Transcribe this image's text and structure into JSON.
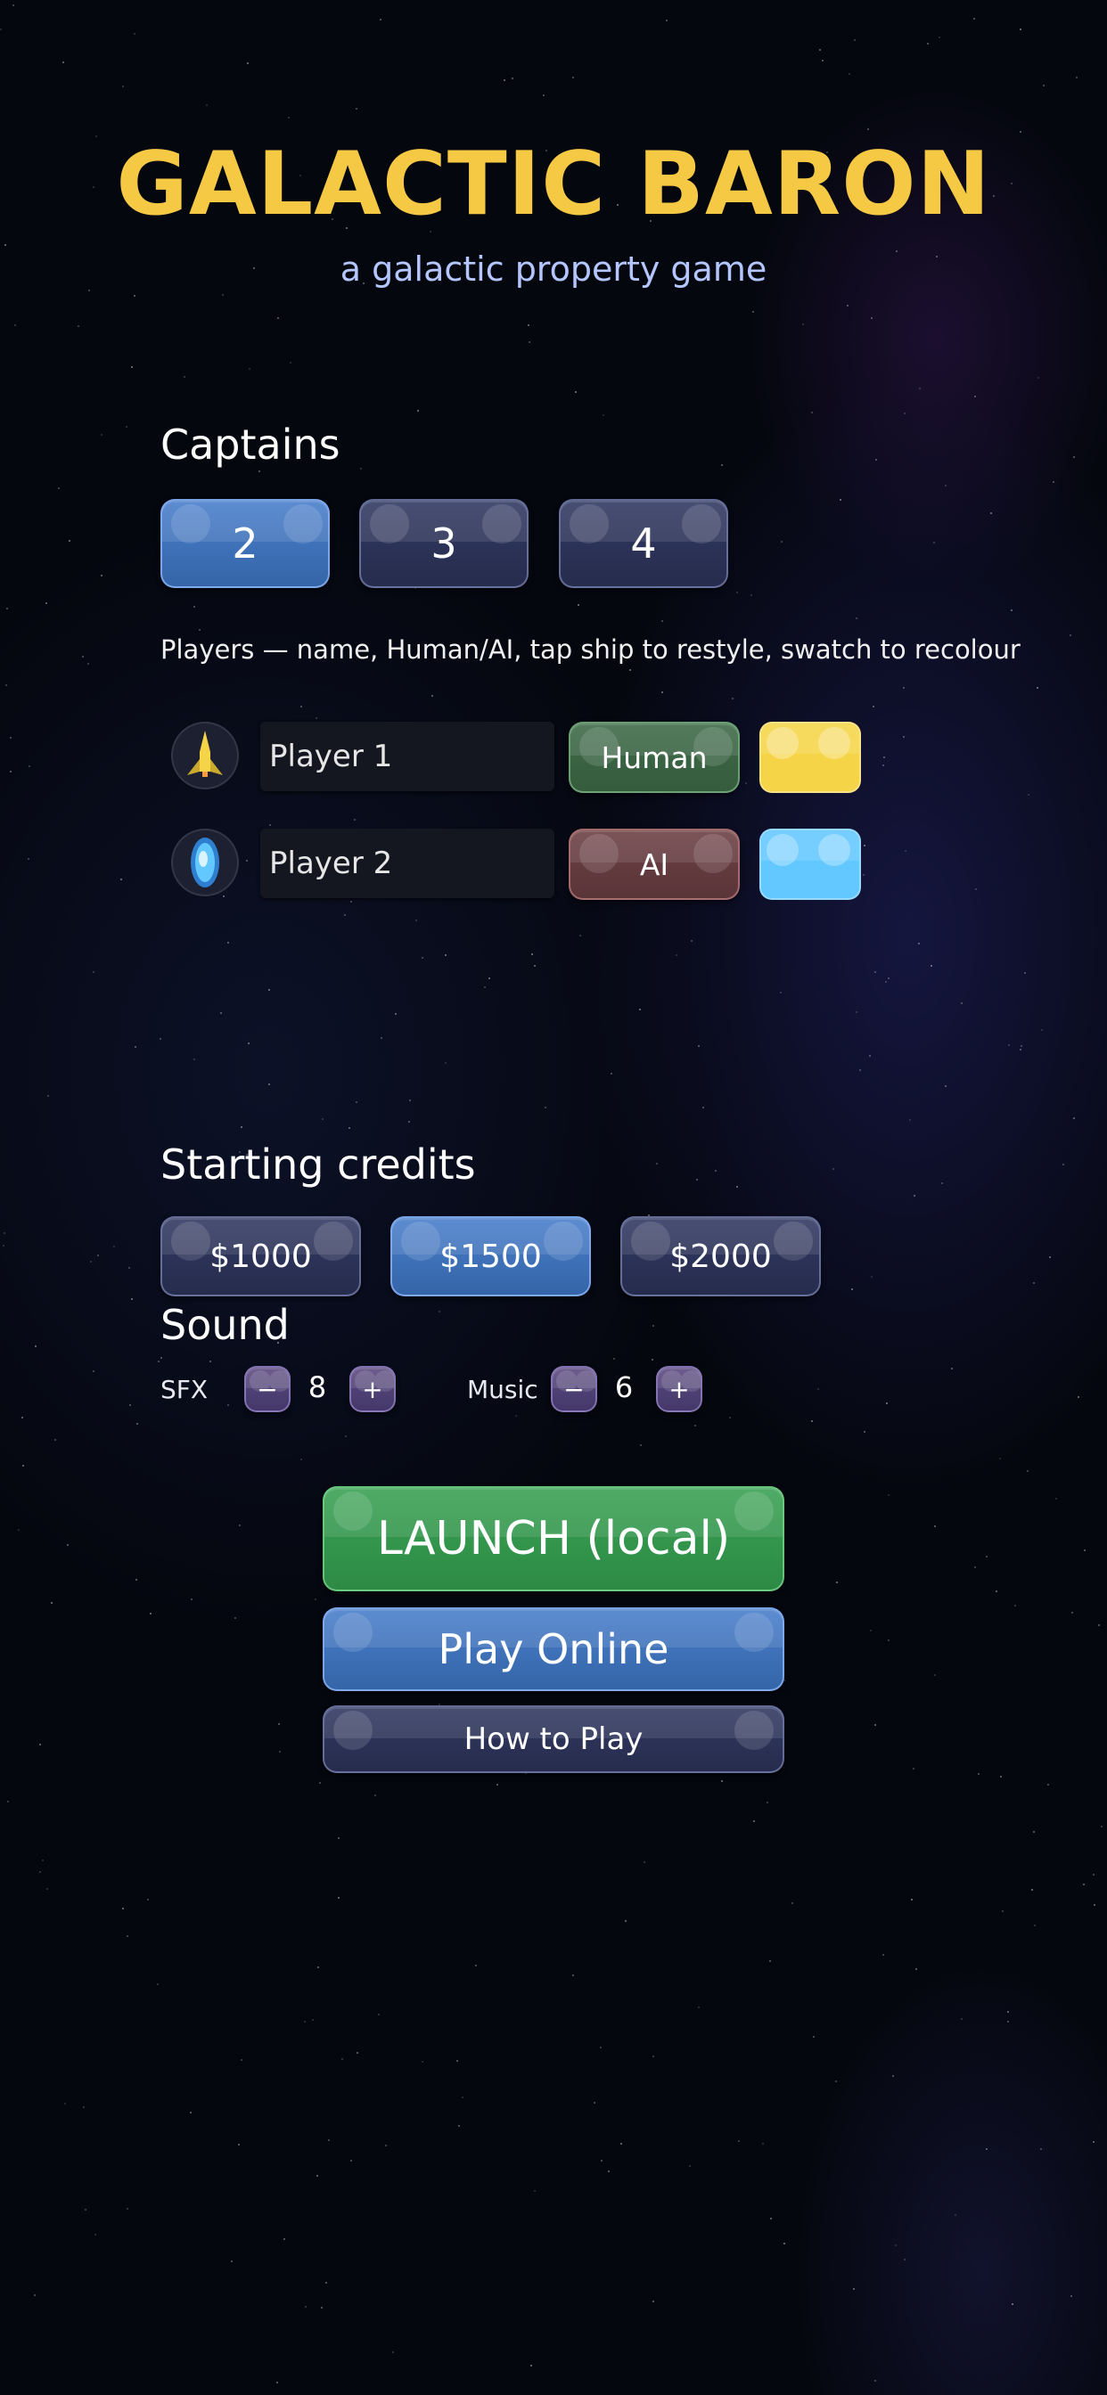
{
  "title": "GALACTIC BARON",
  "subtitle": "a galactic property game",
  "captains": {
    "heading": "Captains",
    "options": [
      "2",
      "3",
      "4"
    ],
    "selected": "2"
  },
  "players_hint": "Players  —  name, Human/AI, tap ship to restyle, swatch to recolour",
  "players": [
    {
      "name": "Player 1",
      "type": "Human",
      "color": "#f5d547",
      "ship_icon": "rocket-ship-icon"
    },
    {
      "name": "Player 2",
      "type": "AI",
      "color": "#62c8ff",
      "ship_icon": "saucer-ship-icon"
    }
  ],
  "credits": {
    "heading": "Starting credits",
    "options": [
      "$1000",
      "$1500",
      "$2000"
    ],
    "selected": "$1500"
  },
  "sound": {
    "heading": "Sound",
    "sfx_label": "SFX",
    "sfx_value": "8",
    "music_label": "Music",
    "music_value": "6",
    "minus": "−",
    "plus": "+"
  },
  "actions": {
    "launch": "LAUNCH (local)",
    "online": "Play Online",
    "how_to": "How to Play"
  },
  "colors": {
    "title": "#f6c945",
    "subtitle": "#b4c6ff",
    "selected_button": "#4a7fcc",
    "launch_button": "#3aa254"
  }
}
